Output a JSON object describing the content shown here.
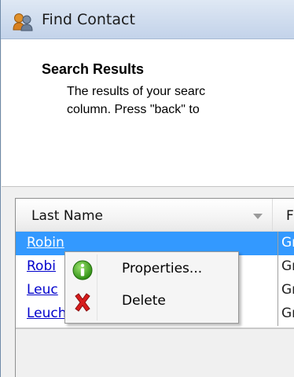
{
  "window": {
    "title": "Find Contact",
    "icon": "contact-person-icon"
  },
  "header": {
    "title": "Search Results",
    "description_line1": "The results of your searc",
    "description_line2": "column.  Press \"back\" to"
  },
  "grid": {
    "columns": [
      {
        "label": "Last Name",
        "sort_icon": "sort-descending-icon"
      },
      {
        "label": "F"
      }
    ],
    "rows": [
      {
        "last_name": "Robin",
        "first_name": "Gr",
        "selected": true
      },
      {
        "last_name": "Robi",
        "first_name": "Gr",
        "selected": false
      },
      {
        "last_name": "Leuc",
        "first_name": "Gr",
        "selected": false
      },
      {
        "last_name": "Leucht",
        "first_name": "Gr",
        "selected": false
      }
    ]
  },
  "context_menu": {
    "items": [
      {
        "label": "Properties...",
        "icon": "info-icon"
      },
      {
        "label": "Delete",
        "icon": "delete-x-icon"
      }
    ]
  },
  "colors": {
    "selection": "#3399ff",
    "link": "#0000cc",
    "info_green": "#3aa01e",
    "delete_red": "#d81c1c"
  }
}
